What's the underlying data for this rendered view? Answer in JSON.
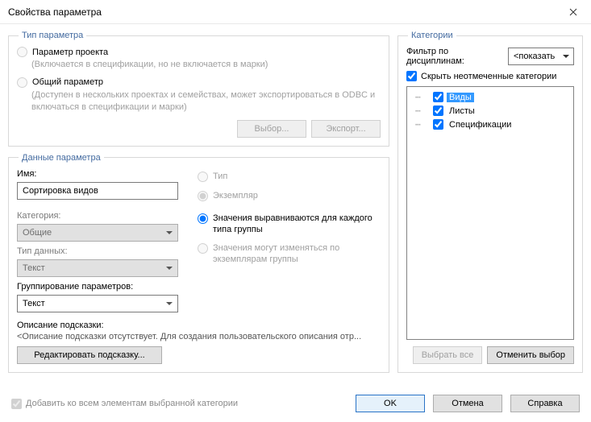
{
  "window": {
    "title": "Свойства параметра"
  },
  "paramType": {
    "legend": "Тип параметра",
    "project": {
      "label": "Параметр проекта",
      "hint": "(Включается в спецификации, но не включается в марки)"
    },
    "shared": {
      "label": "Общий параметр",
      "hint": "(Доступен в нескольких проектах и семействах, может экспортироваться в ODBC и включаться в спецификации и марки)"
    },
    "selectBtn": "Выбор...",
    "exportBtn": "Экспорт..."
  },
  "paramData": {
    "legend": "Данные параметра",
    "nameLabel": "Имя:",
    "nameValue": "Сортировка видов",
    "disciplineLabel": "Категория:",
    "disciplineValue": "Общие",
    "dataTypeLabel": "Тип данных:",
    "dataTypeValue": "Текст",
    "groupLabel": "Группирование параметров:",
    "groupValue": "Текст",
    "typeInstance": {
      "type": "Тип",
      "instance": "Экземпляр"
    },
    "align": {
      "byGroup": "Значения выравниваются для каждого типа группы",
      "byInstance": "Значения могут изменяться по экземплярам группы"
    },
    "tooltipLabel": "Описание подсказки:",
    "tooltipText": "<Описание подсказки отсутствует. Для создания пользовательского описания отр...",
    "editTooltipBtn": "Редактировать подсказку..."
  },
  "categories": {
    "legend": "Категории",
    "filterLabel": "Фильтр по дисциплинам:",
    "filterValue": "<показать",
    "hideUnchecked": "Скрыть неотмеченные категории",
    "items": [
      {
        "label": "Виды",
        "selected": true
      },
      {
        "label": "Листы",
        "selected": false
      },
      {
        "label": "Спецификации",
        "selected": false
      }
    ],
    "selectAllBtn": "Выбрать все",
    "deselectBtn": "Отменить выбор"
  },
  "footer": {
    "addToAll": "Добавить ко всем элементам выбранной категории",
    "ok": "OK",
    "cancel": "Отмена",
    "help": "Справка"
  }
}
